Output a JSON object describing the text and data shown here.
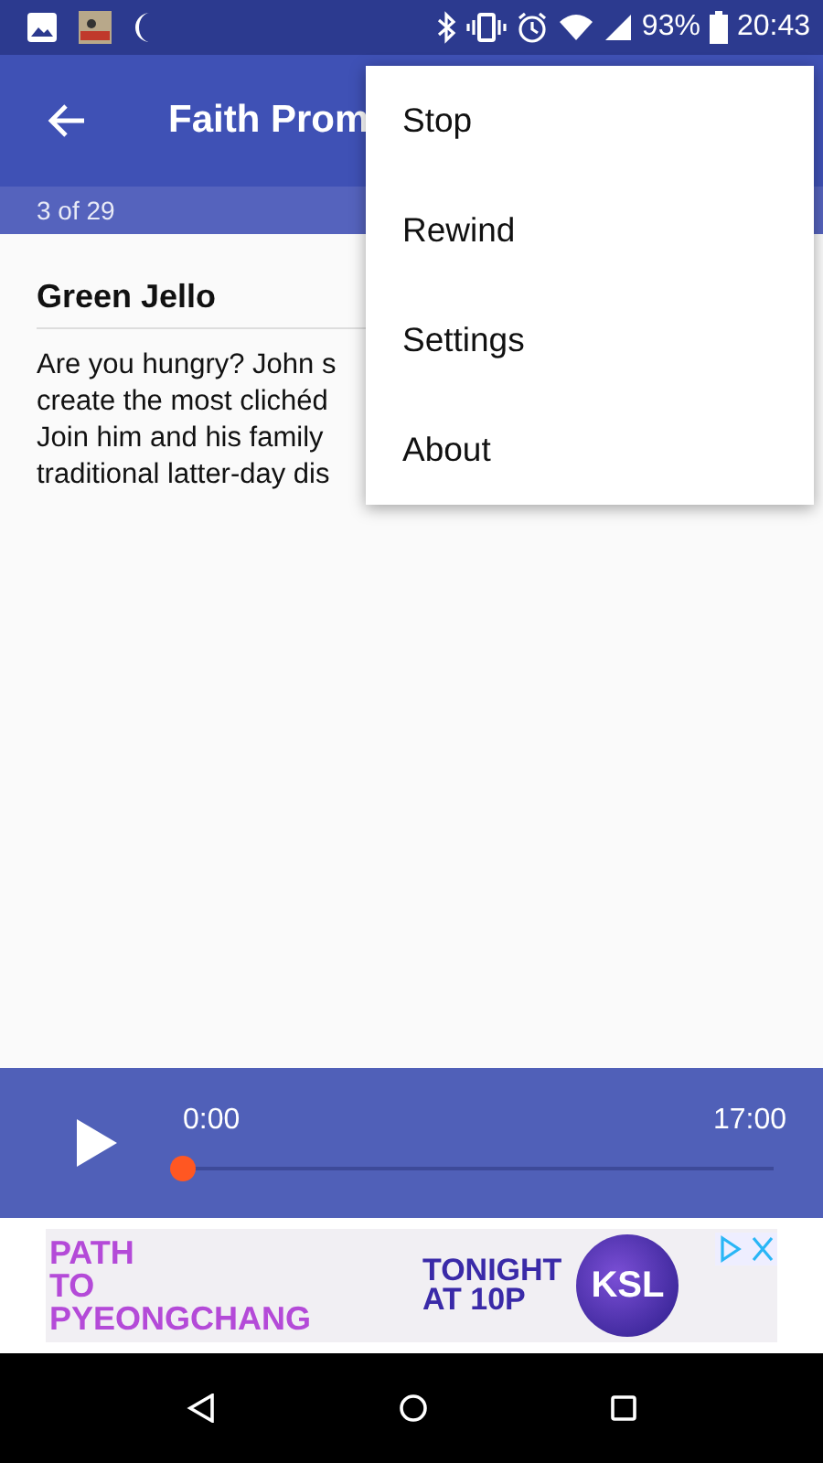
{
  "status_bar": {
    "battery": "93%",
    "time": "20:43"
  },
  "app_bar": {
    "title": "Faith Prom",
    "subtitle": "3 of 29"
  },
  "episode": {
    "title": "Green Jello",
    "description_lines": [
      "Are you hungry? John s",
      "create the most clichéd",
      "Join him and his family",
      "traditional latter-day dis"
    ]
  },
  "menu": {
    "items": [
      {
        "label": "Stop"
      },
      {
        "label": "Rewind"
      },
      {
        "label": "Settings"
      },
      {
        "label": "About"
      }
    ]
  },
  "player": {
    "elapsed": "0:00",
    "duration": "17:00",
    "level": 0
  },
  "ad": {
    "headline": [
      "PATH",
      "TO",
      "PYEONGCHANG"
    ],
    "tagline": [
      "TONIGHT",
      "AT 10P"
    ],
    "brand": "KSL"
  }
}
